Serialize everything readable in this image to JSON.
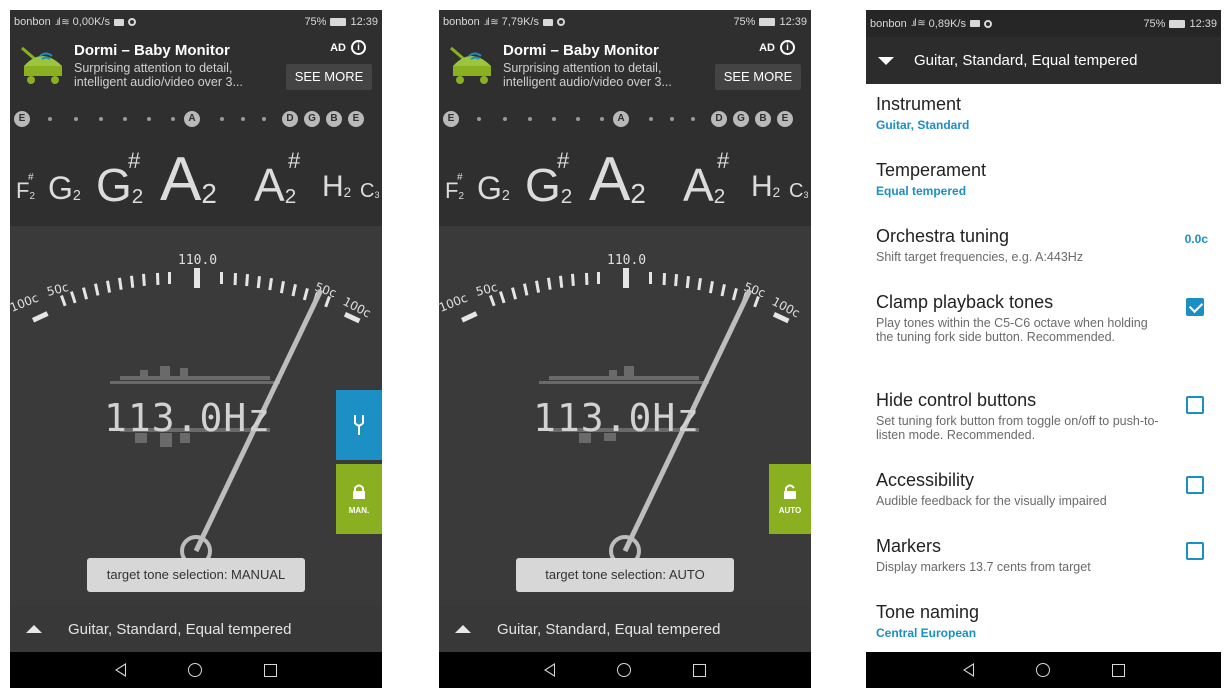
{
  "status_bars": [
    {
      "carrier": "bonbon",
      "speed": "0,00K/s",
      "battery": "75%",
      "time": "12:39"
    },
    {
      "carrier": "bonbon",
      "speed": "7,79K/s",
      "battery": "75%",
      "time": "12:39"
    },
    {
      "carrier": "bonbon",
      "speed": "0,89K/s",
      "battery": "75%",
      "time": "12:39"
    }
  ],
  "ad": {
    "title": "Dormi – Baby Monitor",
    "desc_line1": "Surprising attention to detail,",
    "desc_line2": "intelligent audio/video over 3...",
    "ad_label": "AD",
    "cta": "SEE MORE"
  },
  "note_strip": {
    "letters_left": [
      "E"
    ],
    "letter_center": "A",
    "letters_right": [
      "D",
      "G",
      "B",
      "E"
    ]
  },
  "notes": {
    "fsharp2": {
      "letter": "F",
      "sharp": "#",
      "octave": "2"
    },
    "g2": {
      "letter": "G",
      "octave": "2"
    },
    "gsharp2": {
      "letter": "G",
      "sharp": "#",
      "octave": "2"
    },
    "a2": {
      "letter": "A",
      "octave": "2"
    },
    "asharp2": {
      "letter": "A",
      "sharp": "#",
      "octave": "2"
    },
    "h2": {
      "letter": "H",
      "octave": "2"
    },
    "c3": {
      "letter": "C",
      "octave": "3"
    }
  },
  "meter": {
    "center_label": "110.0",
    "left_100": "100c",
    "left_50": "50c",
    "right_50": "50c",
    "right_100": "100c",
    "frequency": "113.0Hz"
  },
  "panels": [
    {
      "tooltip": "target tone selection: MANUAL",
      "lock_label": "MAN.",
      "bottom_label": "Guitar, Standard, Equal tempered"
    },
    {
      "tooltip": "target tone selection: AUTO",
      "lock_label": "AUTO",
      "bottom_label": "Guitar, Standard, Equal tempered"
    }
  ],
  "settings": {
    "header": "Guitar, Standard, Equal tempered",
    "items": [
      {
        "title": "Instrument",
        "value": "Guitar, Standard"
      },
      {
        "title": "Temperament",
        "value": "Equal tempered"
      },
      {
        "title": "Orchestra tuning",
        "sub": "Shift target frequencies, e.g. A:443Hz",
        "value": "0.0c"
      },
      {
        "title": "Clamp playback tones",
        "sub": "Play tones within the C5-C6 octave when holding the tuning fork side button. Recommended.",
        "checked": true
      },
      {
        "title": "Hide control buttons",
        "sub": "Set tuning fork button from toggle on/off to push-to-listen mode. Recommended.",
        "checked": false
      },
      {
        "title": "Accessibility",
        "sub": "Audible feedback for the visually impaired",
        "checked": false
      },
      {
        "title": "Markers",
        "sub": "Display markers 13.7 cents from target",
        "checked": false
      },
      {
        "title": "Tone naming",
        "value": "Central European"
      }
    ]
  },
  "colors": {
    "accent_blue": "#1c8fc4",
    "lock_green": "#8ab021",
    "tuner_bg": "#3a3a3a"
  }
}
